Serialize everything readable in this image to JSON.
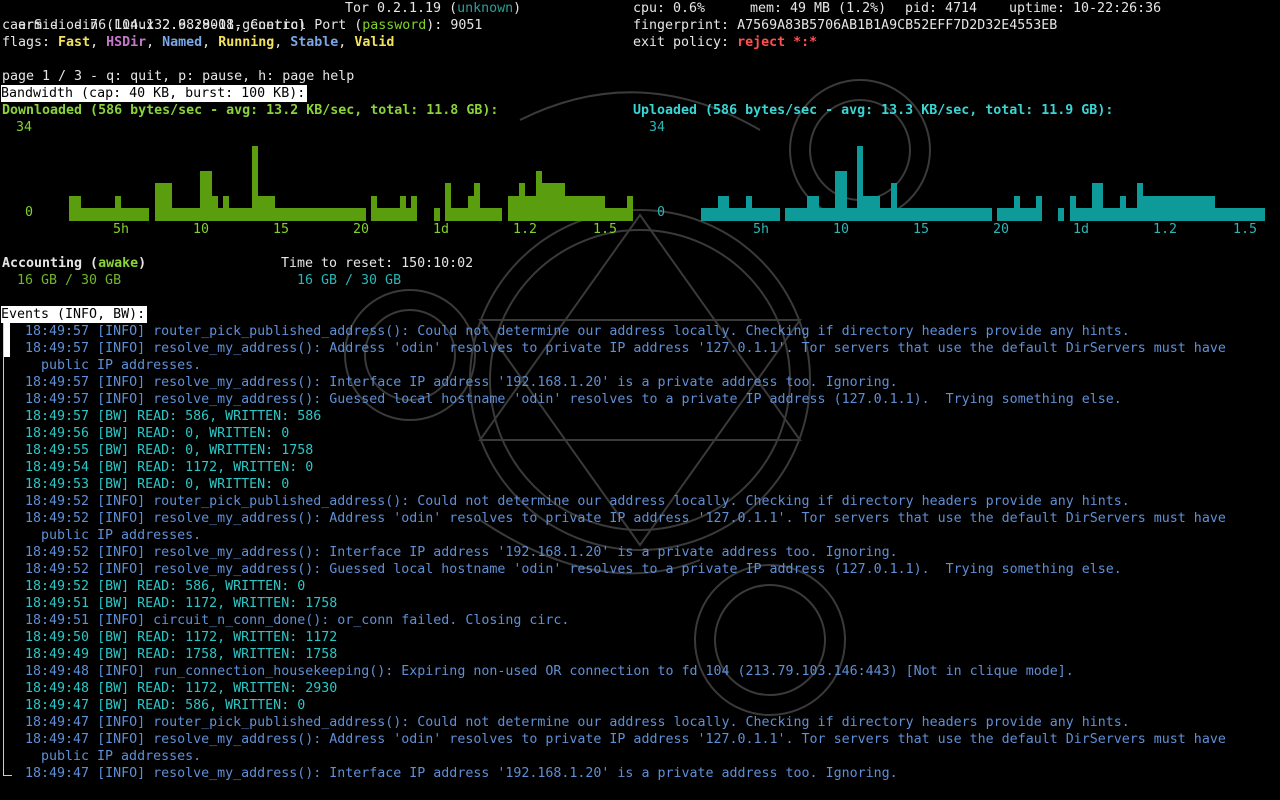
{
  "header": {
    "title_left": "arm - odin (Linux 2.6.28-18-generic)",
    "tor_label": "Tor 0.2.1.19 (",
    "tor_status": "unknown",
    "tor_close": ")",
    "line2_prefix": "caerSidi - 76.104.132.98:9001, Control Port (",
    "control_auth": "password",
    "line2_suffix": "): 9051",
    "flags_label": "flags: ",
    "flags": [
      "Fast",
      "HSDir",
      "Named",
      "Running",
      "Stable",
      "Valid"
    ],
    "cpu": "cpu: 0.6%",
    "mem": "mem: 49 MB (1.2%)",
    "pid": "pid: 4714",
    "uptime": "uptime: 10-22:26:36",
    "fingerprint": "fingerprint: A7569A83B5706AB1B1A9CB52EFF7D2D32E4553EB",
    "exit_policy_label": "exit policy: ",
    "exit_policy": "reject *:*"
  },
  "page_help": "page 1 / 3 - q: quit, p: pause, h: page help",
  "bandwidth": {
    "title": "Bandwidth (cap: 40 KB, burst: 100 KB):",
    "download_label": "Downloaded (586 bytes/sec - avg: 13.2 KB/sec, total: 11.8 GB):",
    "upload_label": "Uploaded (586 bytes/sec - avg: 13.3 KB/sec, total: 11.9 GB):",
    "y_max": "34",
    "y_min": "0",
    "x_ticks": [
      "5h",
      "10",
      "15",
      "20",
      "1d",
      "1.2",
      "1.5"
    ]
  },
  "chart_data": [
    {
      "type": "bar",
      "title": "Downloaded",
      "ylim": [
        0,
        34
      ],
      "values": [
        0,
        0,
        0,
        0,
        0,
        10,
        10,
        5,
        5,
        5,
        5,
        5,
        5,
        10,
        5,
        5,
        5,
        5,
        5,
        0,
        15,
        15,
        15,
        5,
        5,
        5,
        5,
        5,
        20,
        20,
        10,
        5,
        10,
        5,
        5,
        5,
        5,
        30,
        10,
        10,
        10,
        5,
        5,
        5,
        5,
        5,
        5,
        5,
        5,
        5,
        5,
        5,
        5,
        5,
        5,
        5,
        5,
        0,
        10,
        5,
        5,
        5,
        5,
        10,
        5,
        10,
        0,
        0,
        0,
        5,
        0,
        15,
        5,
        5,
        5,
        10,
        15,
        5,
        5,
        5,
        5,
        0,
        10,
        10,
        15,
        10,
        10,
        20,
        15,
        15,
        15,
        15,
        10,
        10,
        10,
        10,
        10,
        10,
        10,
        5,
        5,
        5,
        5,
        10
      ]
    },
    {
      "type": "bar",
      "title": "Uploaded",
      "ylim": [
        0,
        34
      ],
      "values": [
        0,
        0,
        0,
        0,
        0,
        5,
        5,
        5,
        10,
        10,
        5,
        5,
        5,
        10,
        5,
        5,
        5,
        5,
        5,
        0,
        5,
        5,
        5,
        5,
        10,
        10,
        5,
        5,
        5,
        20,
        20,
        5,
        5,
        30,
        10,
        10,
        10,
        5,
        5,
        15,
        5,
        5,
        5,
        5,
        5,
        5,
        5,
        5,
        5,
        5,
        5,
        5,
        5,
        5,
        5,
        5,
        5,
        0,
        5,
        5,
        5,
        10,
        5,
        5,
        5,
        10,
        0,
        0,
        0,
        5,
        0,
        10,
        5,
        5,
        5,
        15,
        15,
        5,
        5,
        5,
        10,
        5,
        5,
        15,
        10,
        10,
        10,
        10,
        10,
        10,
        10,
        10,
        10,
        10,
        10,
        10,
        10,
        5,
        5,
        5,
        5,
        5,
        5,
        5,
        5,
        5
      ]
    }
  ],
  "accounting": {
    "label": "Accounting (",
    "status": "awake",
    "label_close": ")",
    "used_left": "16 GB / 30 GB",
    "reset": "Time to reset: 150:10:02",
    "used_right": "16 GB / 30 GB"
  },
  "events": {
    "title": "Events (INFO, BW):",
    "lines": [
      {
        "time": "18:49:57",
        "type": "[INFO]",
        "text": "router_pick_published_address(): Could not determine our address locally. Checking if directory headers provide any hints."
      },
      {
        "time": "18:49:57",
        "type": "[INFO]",
        "text": "resolve_my_address(): Address 'odin' resolves to private IP address '127.0.1.1'. Tor servers that use the default DirServers must have"
      },
      {
        "time": "",
        "type": "",
        "text": "public IP addresses."
      },
      {
        "time": "18:49:57",
        "type": "[INFO]",
        "text": "resolve_my_address(): Interface IP address '192.168.1.20' is a private address too. Ignoring."
      },
      {
        "time": "18:49:57",
        "type": "[INFO]",
        "text": "resolve_my_address(): Guessed local hostname 'odin' resolves to a private IP address (127.0.1.1).  Trying something else."
      },
      {
        "time": "18:49:57",
        "type": "[BW]",
        "text": "READ: 586, WRITTEN: 586"
      },
      {
        "time": "18:49:56",
        "type": "[BW]",
        "text": "READ: 0, WRITTEN: 0"
      },
      {
        "time": "18:49:55",
        "type": "[BW]",
        "text": "READ: 0, WRITTEN: 1758"
      },
      {
        "time": "18:49:54",
        "type": "[BW]",
        "text": "READ: 1172, WRITTEN: 0"
      },
      {
        "time": "18:49:53",
        "type": "[BW]",
        "text": "READ: 0, WRITTEN: 0"
      },
      {
        "time": "18:49:52",
        "type": "[INFO]",
        "text": "router_pick_published_address(): Could not determine our address locally. Checking if directory headers provide any hints."
      },
      {
        "time": "18:49:52",
        "type": "[INFO]",
        "text": "resolve_my_address(): Address 'odin' resolves to private IP address '127.0.1.1'. Tor servers that use the default DirServers must have"
      },
      {
        "time": "",
        "type": "",
        "text": "public IP addresses."
      },
      {
        "time": "18:49:52",
        "type": "[INFO]",
        "text": "resolve_my_address(): Interface IP address '192.168.1.20' is a private address too. Ignoring."
      },
      {
        "time": "18:49:52",
        "type": "[INFO]",
        "text": "resolve_my_address(): Guessed local hostname 'odin' resolves to a private IP address (127.0.1.1).  Trying something else."
      },
      {
        "time": "18:49:52",
        "type": "[BW]",
        "text": "READ: 586, WRITTEN: 0"
      },
      {
        "time": "18:49:51",
        "type": "[BW]",
        "text": "READ: 1172, WRITTEN: 1758"
      },
      {
        "time": "18:49:51",
        "type": "[INFO]",
        "text": "circuit_n_conn_done(): or_conn failed. Closing circ."
      },
      {
        "time": "18:49:50",
        "type": "[BW]",
        "text": "READ: 1172, WRITTEN: 1172"
      },
      {
        "time": "18:49:49",
        "type": "[BW]",
        "text": "READ: 1758, WRITTEN: 1758"
      },
      {
        "time": "18:49:48",
        "type": "[INFO]",
        "text": "run_connection_housekeeping(): Expiring non-used OR connection to fd 104 (213.79.103.146:443) [Not in clique mode]."
      },
      {
        "time": "18:49:48",
        "type": "[BW]",
        "text": "READ: 1172, WRITTEN: 2930"
      },
      {
        "time": "18:49:47",
        "type": "[BW]",
        "text": "READ: 586, WRITTEN: 0"
      },
      {
        "time": "18:49:47",
        "type": "[INFO]",
        "text": "router_pick_published_address(): Could not determine our address locally. Checking if directory headers provide any hints."
      },
      {
        "time": "18:49:47",
        "type": "[INFO]",
        "text": "resolve_my_address(): Address 'odin' resolves to private IP address '127.0.1.1'. Tor servers that use the default DirServers must have"
      },
      {
        "time": "",
        "type": "",
        "text": "public IP addresses."
      },
      {
        "time": "18:49:47",
        "type": "[INFO]",
        "text": "resolve_my_address(): Interface IP address '192.168.1.20' is a private address too. Ignoring."
      }
    ]
  },
  "colors": {
    "download_bars": "#5a9e0f",
    "upload_bars": "#0f9a9a"
  }
}
